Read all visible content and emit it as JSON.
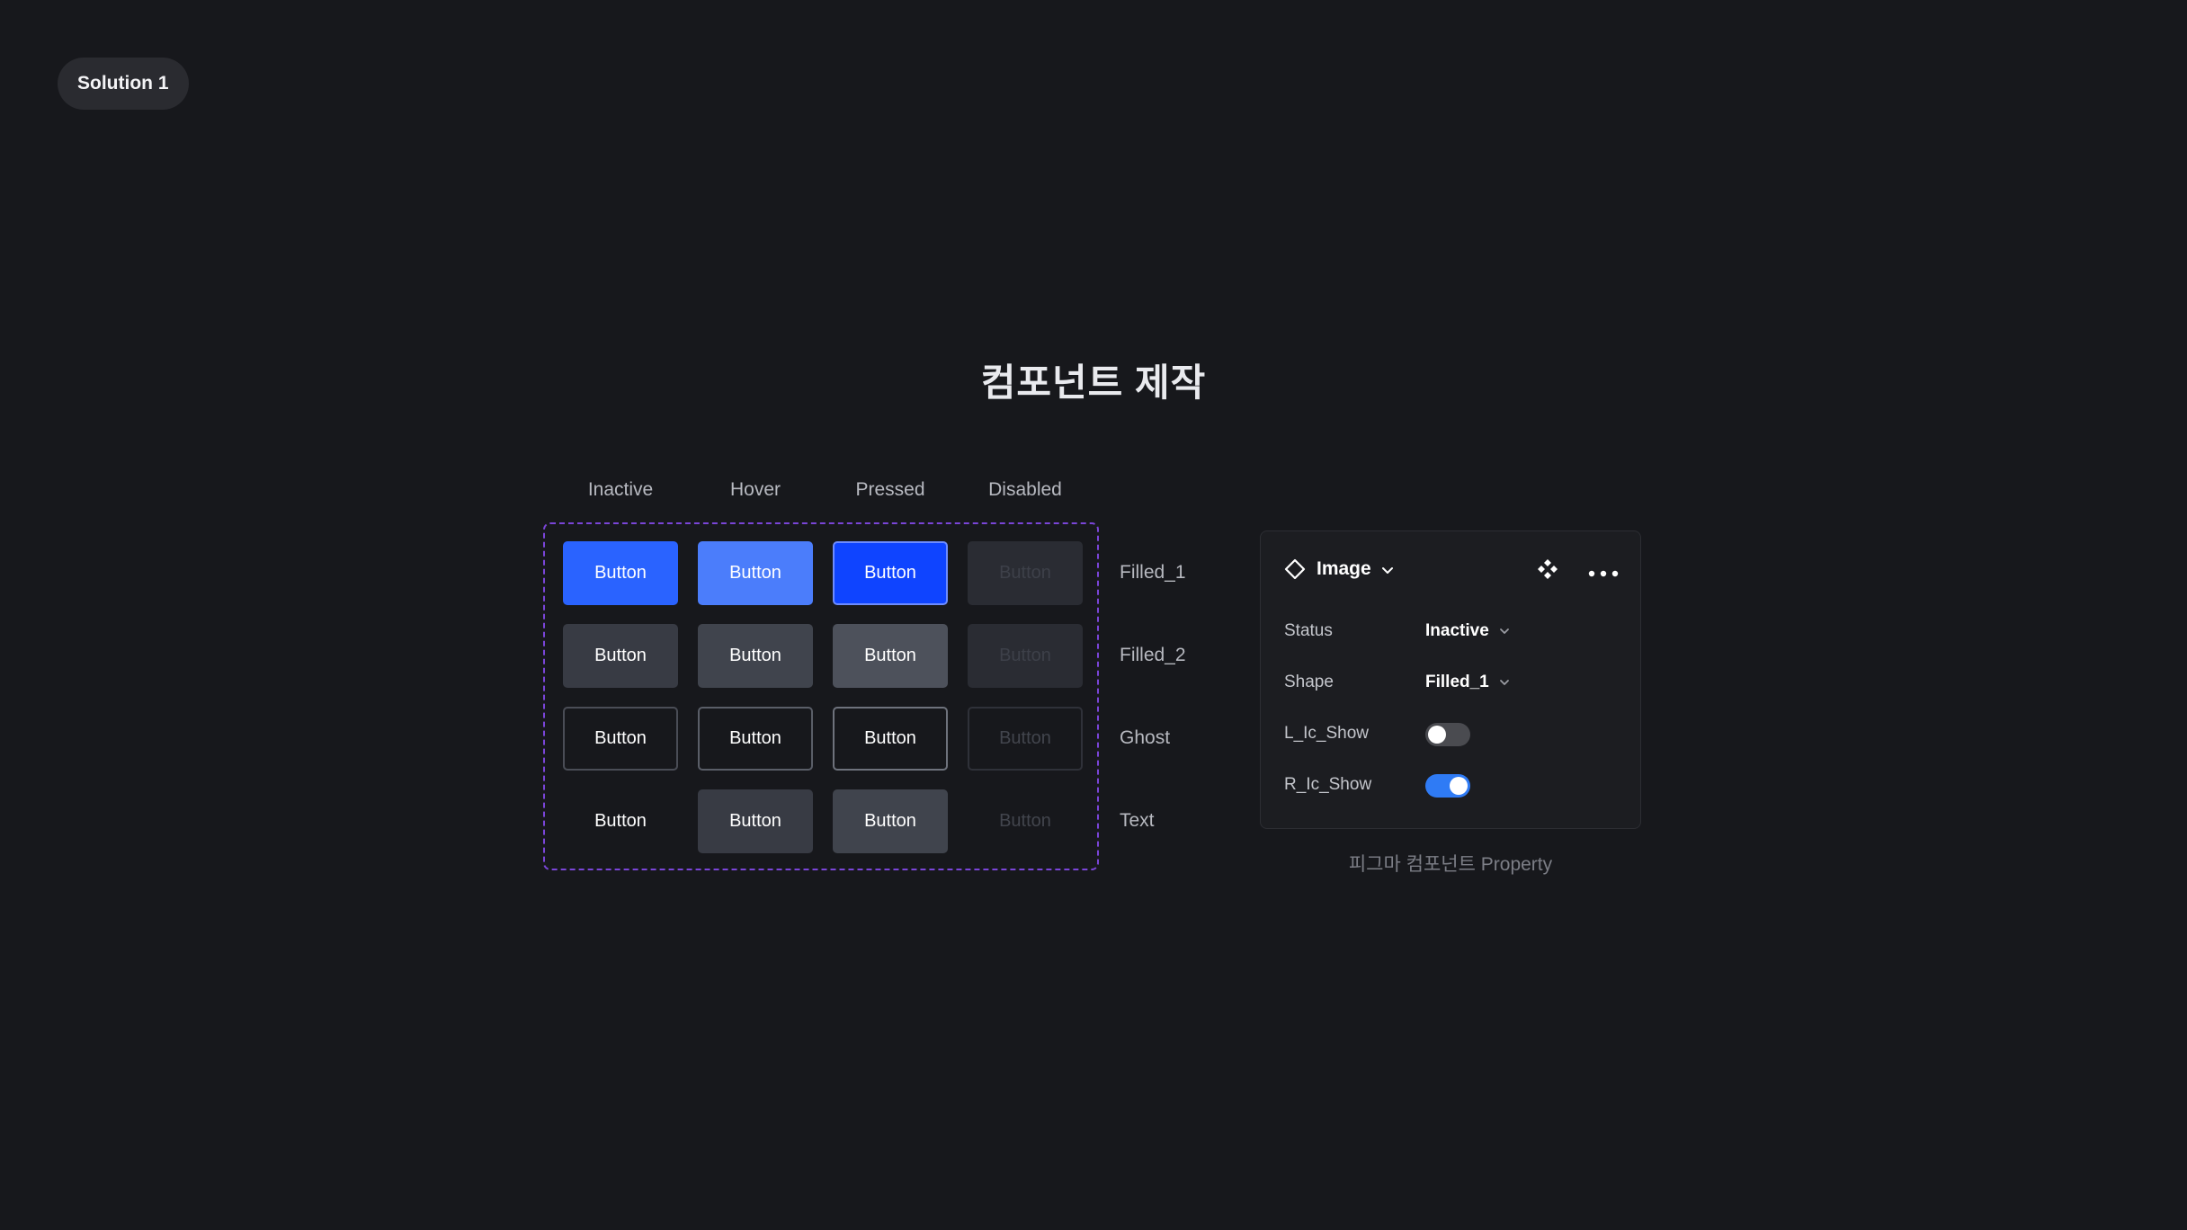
{
  "header": {
    "solution_label": "Solution 1"
  },
  "title": "컴포넌트 제작",
  "columns": [
    "Inactive",
    "Hover",
    "Pressed",
    "Disabled"
  ],
  "rows": [
    {
      "label": "Filled_1",
      "buttons": [
        "Button",
        "Button",
        "Button",
        "Button"
      ]
    },
    {
      "label": "Filled_2",
      "buttons": [
        "Button",
        "Button",
        "Button",
        "Button"
      ]
    },
    {
      "label": "Ghost",
      "buttons": [
        "Button",
        "Button",
        "Button",
        "Button"
      ]
    },
    {
      "label": "Text",
      "buttons": [
        "Button",
        "Button",
        "Button",
        "Button"
      ]
    }
  ],
  "colors": {
    "accent_blue": "#2a63ff",
    "frame_purple": "#7a45d8",
    "toggle_on": "#2f7bf5"
  },
  "panel": {
    "title": "Image",
    "icons": [
      "diamond-icon",
      "chevron-down-icon",
      "component-icon",
      "more-icon"
    ],
    "properties": [
      {
        "label": "Status",
        "value": "Inactive"
      },
      {
        "label": "Shape",
        "value": "Filled_1"
      }
    ],
    "toggles": [
      {
        "label": "L_Ic_Show",
        "on": false
      },
      {
        "label": "R_Ic_Show",
        "on": true
      }
    ],
    "caption": "피그마 컴포넌트 Property"
  }
}
